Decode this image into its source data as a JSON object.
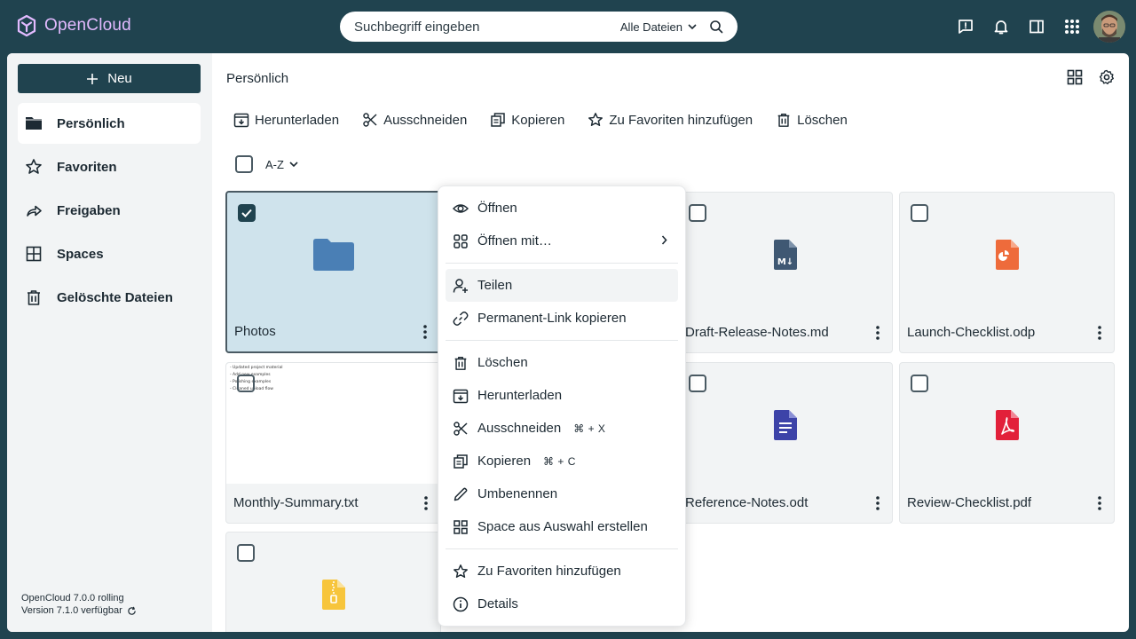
{
  "app": {
    "name": "OpenCloud",
    "brand_color": "#20434f",
    "accent_color": "#e2baff"
  },
  "search": {
    "placeholder": "Suchbegriff eingeben",
    "scope": "Alle Dateien"
  },
  "topbar_icons": [
    "feedback-icon",
    "bell-icon",
    "sidebar-toggle-icon",
    "apps-grid-icon",
    "avatar"
  ],
  "sidebar": {
    "new_label": "Neu",
    "items": [
      {
        "label": "Persönlich",
        "icon": "folder-icon",
        "active": true
      },
      {
        "label": "Favoriten",
        "icon": "star-icon",
        "active": false
      },
      {
        "label": "Freigaben",
        "icon": "share-icon",
        "active": false
      },
      {
        "label": "Spaces",
        "icon": "spaces-icon",
        "active": false
      },
      {
        "label": "Gelöschte Dateien",
        "icon": "trash-icon",
        "active": false
      }
    ],
    "version_line1": "OpenCloud 7.0.0 rolling",
    "version_line2": "Version 7.1.0 verfügbar"
  },
  "content": {
    "breadcrumb": "Persönlich",
    "actions": [
      {
        "label": "Herunterladen",
        "icon": "download-icon"
      },
      {
        "label": "Ausschneiden",
        "icon": "scissors-icon"
      },
      {
        "label": "Kopieren",
        "icon": "copy-icon"
      },
      {
        "label": "Zu Favoriten hinzufügen",
        "icon": "star-icon"
      },
      {
        "label": "Löschen",
        "icon": "trash-icon"
      }
    ],
    "sort_label": "A-Z",
    "tiles": [
      {
        "name": "Photos",
        "type": "folder",
        "selected": true
      },
      {
        "name": "Draft-Release-Notes.md",
        "type": "markdown",
        "selected": false
      },
      {
        "name": "Launch-Checklist.odp",
        "type": "presentation",
        "selected": false
      },
      {
        "name": "Monthly-Summary.txt",
        "type": "text",
        "selected": false
      },
      {
        "name": "Reference-Notes.odt",
        "type": "document",
        "selected": false
      },
      {
        "name": "Review-Checklist.pdf",
        "type": "pdf",
        "selected": false
      },
      {
        "name": "",
        "type": "archive",
        "selected": false
      }
    ],
    "txt_preview_lines": [
      "- Updated project material",
      "- Add new examples",
      "- Polishing examples",
      "- Cleaned upload flow"
    ]
  },
  "context_menu": {
    "items": [
      {
        "label": "Öffnen",
        "icon": "eye-icon"
      },
      {
        "label": "Öffnen mit…",
        "icon": "apps-icon",
        "submenu": true
      },
      {
        "label": "Teilen",
        "icon": "add-user-icon",
        "hover": true
      },
      {
        "label": "Permanent-Link kopieren",
        "icon": "link-icon"
      },
      {
        "label": "Löschen",
        "icon": "trash-icon"
      },
      {
        "label": "Herunterladen",
        "icon": "download-icon"
      },
      {
        "label": "Ausschneiden",
        "icon": "scissors-icon",
        "shortcut": "⌘ + X"
      },
      {
        "label": "Kopieren",
        "icon": "copy-icon",
        "shortcut": "⌘ + C"
      },
      {
        "label": "Umbenennen",
        "icon": "pencil-icon"
      },
      {
        "label": "Space aus Auswahl erstellen",
        "icon": "spaces-icon"
      },
      {
        "label": "Zu Favoriten hinzufügen",
        "icon": "star-icon"
      },
      {
        "label": "Details",
        "icon": "info-icon"
      }
    ]
  }
}
